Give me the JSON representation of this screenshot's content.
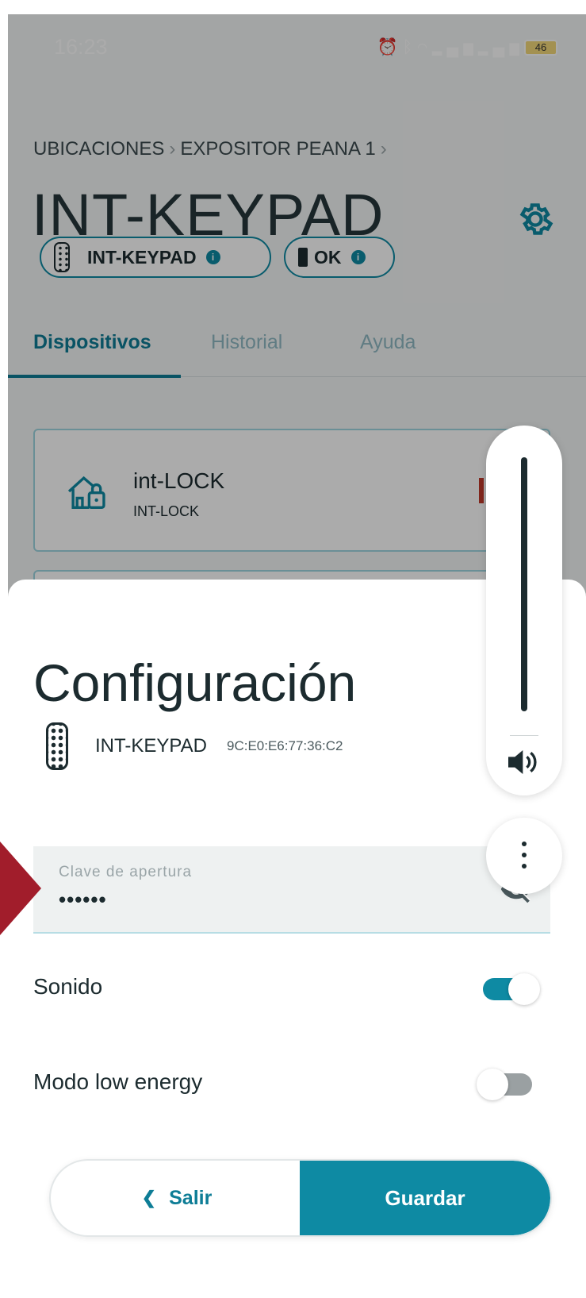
{
  "status_bar": {
    "time": "16:23",
    "battery": "46"
  },
  "breadcrumb": {
    "items": [
      "UBICACIONES",
      "EXPOSITOR PEANA 1"
    ]
  },
  "page": {
    "title": "INT-KEYPAD",
    "settings_icon": "gear-icon"
  },
  "chips": {
    "device_label": "INT-KEYPAD",
    "battery_label": "OK"
  },
  "tabs": [
    {
      "label": "Dispositivos",
      "active": true
    },
    {
      "label": "Historial",
      "active": false
    },
    {
      "label": "Ayuda",
      "active": false
    }
  ],
  "device_list": [
    {
      "name": "int-LOCK",
      "model": "INT-LOCK",
      "icon": "house-lock-icon"
    }
  ],
  "config_sheet": {
    "title": "Configuración",
    "device_name": "INT-KEYPAD",
    "device_mac": "9C:E0:E6:77:36:C2",
    "password_field": {
      "label": "Clave de apertura",
      "value": "••••••"
    },
    "sound": {
      "label": "Sonido",
      "on": true
    },
    "low_energy": {
      "label": "Modo low energy",
      "on": false
    },
    "exit_label": "Salir",
    "save_label": "Guardar"
  },
  "colors": {
    "accent": "#0e8aa3",
    "accent_dark": "#0e7d96",
    "text": "#1c2b2f",
    "delete": "#c0392b"
  }
}
